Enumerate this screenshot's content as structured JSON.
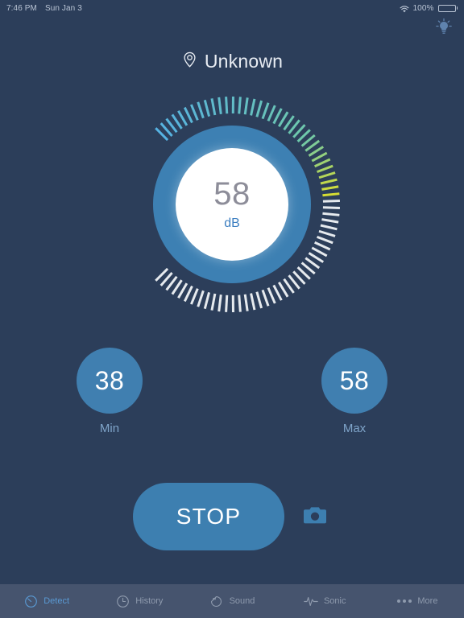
{
  "status_bar": {
    "time": "7:46 PM",
    "date": "Sun Jan 3",
    "wifi_icon": "wifi-icon",
    "battery_percent": "100%",
    "battery_icon": "battery-full-icon"
  },
  "topbar": {
    "bulb_icon": "lightbulb-icon"
  },
  "header": {
    "location_icon": "location-pin-icon",
    "title": "Unknown"
  },
  "gauge": {
    "value": "58",
    "unit": "dB",
    "min_scale": 0,
    "max_scale": 120,
    "current": 58,
    "tick_count": 72,
    "start_angle_deg": 225,
    "sweep_deg": 270,
    "disc_color": "#3d80b3",
    "inner_color": "#ffffff",
    "tick_active_color": "#5ab4e8",
    "tick_inactive_color": "#e6eaee",
    "tick_peak_color": "#d6dd33",
    "value_color": "#8d8d99",
    "unit_color": "#3d7fc1"
  },
  "stats": [
    {
      "name": "min",
      "value": "38",
      "label": "Min"
    },
    {
      "name": "max",
      "value": "58",
      "label": "Max"
    }
  ],
  "actions": {
    "stop_label": "STOP",
    "camera_icon": "camera-icon"
  },
  "progress": {
    "color": "#6e7f6b",
    "percent": 100
  },
  "tabbar": {
    "items": [
      {
        "label": "Detect",
        "icon": "gauge-icon",
        "active": true
      },
      {
        "label": "History",
        "icon": "clock-icon",
        "active": false
      },
      {
        "label": "Sound",
        "icon": "sound-pie-icon",
        "active": false
      },
      {
        "label": "Sonic",
        "icon": "waveform-icon",
        "active": false
      },
      {
        "label": "More",
        "icon": "ellipsis-icon",
        "active": false
      }
    ],
    "background": "#46546e",
    "active_color": "#5a9ad4",
    "inactive_color": "#8e9aad"
  },
  "theme": {
    "background": "#2c3e5a",
    "accent_blue": "#3d80b3"
  }
}
